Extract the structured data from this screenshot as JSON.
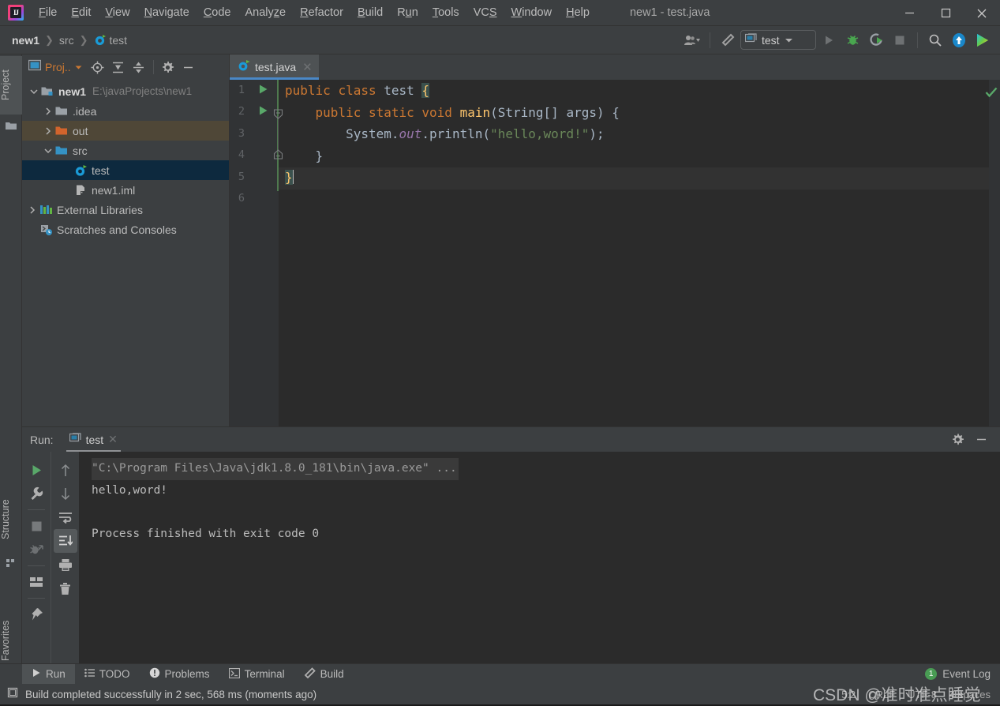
{
  "window": {
    "title": "new1 - test.java",
    "controls": {
      "minimize": "minimize-icon",
      "maximize": "maximize-icon",
      "close": "close-icon"
    }
  },
  "menubar": {
    "logo": "intellij-idea-logo",
    "items": [
      {
        "label": "File",
        "mnemonic": "F"
      },
      {
        "label": "Edit",
        "mnemonic": "E"
      },
      {
        "label": "View",
        "mnemonic": "V"
      },
      {
        "label": "Navigate",
        "mnemonic": "N"
      },
      {
        "label": "Code",
        "mnemonic": "C"
      },
      {
        "label": "Analyze",
        "mnemonic": "z"
      },
      {
        "label": "Refactor",
        "mnemonic": "R"
      },
      {
        "label": "Build",
        "mnemonic": "B"
      },
      {
        "label": "Run",
        "mnemonic": "u"
      },
      {
        "label": "Tools",
        "mnemonic": "T"
      },
      {
        "label": "VCS",
        "mnemonic": "S"
      },
      {
        "label": "Window",
        "mnemonic": "W"
      },
      {
        "label": "Help",
        "mnemonic": "H"
      }
    ]
  },
  "toolbar": {
    "breadcrumbs": [
      {
        "label": "new1",
        "bold": true
      },
      {
        "label": "src",
        "bold": false
      },
      {
        "label": "test",
        "bold": false,
        "icon": "java-class-icon"
      }
    ],
    "run_config": {
      "label": "test",
      "icon": "run-config-icon",
      "chevron": "chevron-down-icon"
    },
    "buttons": [
      "user-avatar-icon",
      "hammer-build-icon",
      "run-icon",
      "debug-icon",
      "run-coverage-icon",
      "stop-icon",
      "search-everywhere-icon",
      "update-project-icon",
      "ide-assistant-icon"
    ]
  },
  "left_strip": {
    "top_tab": "Project",
    "bottom_tabs": [
      "Structure",
      "Favorites"
    ]
  },
  "project_panel": {
    "header_title": "Proj..",
    "header_buttons": [
      "locate-icon",
      "expand-all-icon",
      "collapse-all-icon",
      "gear-icon",
      "minimize-icon"
    ],
    "tree": [
      {
        "label": "new1",
        "path": "E:\\javaProjects\\new1",
        "icon": "module-folder-icon",
        "arrow": "chevron-down-icon",
        "indent": 0,
        "bold": true,
        "state": "normal"
      },
      {
        "label": ".idea",
        "icon": "folder-icon",
        "arrow": "chevron-right-icon",
        "indent": 1,
        "bold": false,
        "state": "normal"
      },
      {
        "label": "out",
        "icon": "folder-orange-icon",
        "arrow": "chevron-right-icon",
        "indent": 1,
        "bold": false,
        "state": "highlight"
      },
      {
        "label": "src",
        "icon": "folder-blue-icon",
        "arrow": "chevron-down-icon",
        "indent": 1,
        "bold": false,
        "state": "normal"
      },
      {
        "label": "test",
        "icon": "java-class-icon",
        "arrow": "",
        "indent": 2,
        "bold": false,
        "state": "selected"
      },
      {
        "label": "new1.iml",
        "icon": "iml-file-icon",
        "arrow": "",
        "indent": 2,
        "bold": false,
        "state": "normal"
      },
      {
        "label": "External Libraries",
        "icon": "libraries-icon",
        "arrow": "chevron-right-icon",
        "indent": 0,
        "bold": false,
        "state": "normal"
      },
      {
        "label": "Scratches and Consoles",
        "icon": "scratches-icon",
        "arrow": "",
        "indent": 0,
        "bold": false,
        "state": "normal"
      }
    ]
  },
  "editor": {
    "tab": {
      "label": "test.java",
      "icon": "java-class-icon",
      "close": "close-icon"
    },
    "inspection_status": "checkmark-ok-icon",
    "lines": [
      {
        "num": "1",
        "gutter_run": true,
        "fold": ""
      },
      {
        "num": "2",
        "gutter_run": true,
        "fold": "fold-collapse-icon"
      },
      {
        "num": "3",
        "gutter_run": false,
        "fold": ""
      },
      {
        "num": "4",
        "gutter_run": false,
        "fold": "fold-end-icon"
      },
      {
        "num": "5",
        "gutter_run": false,
        "fold": ""
      },
      {
        "num": "6",
        "gutter_run": false,
        "fold": ""
      }
    ],
    "code": {
      "l1": "public class test {",
      "l2": "    public static void main(String[] args) {",
      "l3": "        System.out.println(\"hello,word!\");",
      "l4": "    }",
      "l5": "}"
    }
  },
  "run_panel": {
    "label": "Run:",
    "tab": {
      "label": "test",
      "icon": "run-config-icon",
      "close": "close-icon"
    },
    "header_buttons": [
      "gear-icon",
      "minimize-icon"
    ],
    "toolbar_left": [
      "rerun-icon",
      "wrench-settings-icon",
      "stop-icon",
      "stop-debug-icon",
      "layout-icon",
      "pin-icon"
    ],
    "toolbar_right": [
      "arrow-up-icon",
      "arrow-down-icon",
      "soft-wrap-icon",
      "scroll-to-end-icon",
      "print-icon",
      "trash-icon"
    ],
    "console": {
      "command": "\"C:\\Program Files\\Java\\jdk1.8.0_181\\bin\\java.exe\" ...",
      "output": "hello,word!",
      "blank": "",
      "exit": "Process finished with exit code 0"
    }
  },
  "tool_buttons_bar": {
    "items": [
      {
        "label": "Run",
        "icon": "run-icon",
        "selected": true
      },
      {
        "label": "TODO",
        "icon": "todo-icon",
        "selected": false
      },
      {
        "label": "Problems",
        "icon": "problems-icon",
        "selected": false
      },
      {
        "label": "Terminal",
        "icon": "terminal-icon",
        "selected": false
      },
      {
        "label": "Build",
        "icon": "build-hammer-icon",
        "selected": false
      }
    ],
    "event_log": {
      "label": "Event Log",
      "count": "1"
    }
  },
  "status_bar": {
    "icon": "status-widget-icon",
    "message": "Build completed successfully in 2 sec, 568 ms (moments ago)",
    "caret_position": "5:2",
    "line_separator": "CRLF",
    "encoding": "UTF-8",
    "indent": "4 spaces"
  },
  "watermark": {
    "text": "CSDN @准时准点睡觉"
  },
  "colors": {
    "chrome": "#3c3f41",
    "editor_bg": "#2b2b2b",
    "gutter_bg": "#313335",
    "accent_blue": "#4a88c7",
    "selection_blue": "#0d293e",
    "highlight_tan": "#4f4737",
    "keyword_orange": "#cc7832",
    "method_yellow": "#ffc66d",
    "string_green": "#6a8759",
    "field_purple": "#9876aa",
    "text_grey": "#a9b7c6",
    "green_ok": "#499c54"
  }
}
